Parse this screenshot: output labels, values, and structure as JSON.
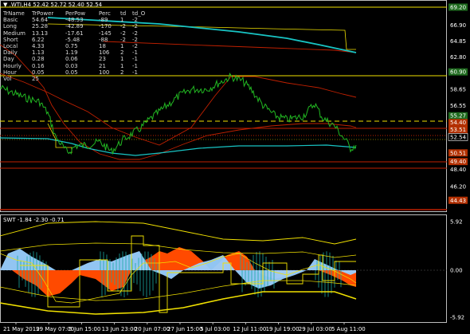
{
  "header": {
    "symbol": "▼ .WTI,H4",
    "ohlc": "52.42 52.72 52.40 52.54"
  },
  "table": {
    "columns": [
      "TrName",
      "TrPower",
      "PerPow",
      "Perc",
      "td",
      "td_O"
    ],
    "rows": [
      [
        "Basic",
        "54.64",
        "-48.53",
        "-89",
        "1",
        "-2"
      ],
      [
        "Long",
        "25.28",
        "-42.89",
        "-170",
        "-2",
        "-2"
      ],
      [
        "Medium",
        "13.13",
        "-17.61",
        "-145",
        "-2",
        "-2"
      ],
      [
        "Short",
        "6.22",
        "-5.48",
        "-88",
        "-2",
        "-2"
      ],
      [
        "Local",
        "4.33",
        "0.75",
        "18",
        "1",
        "-2"
      ],
      [
        "Daily",
        "1.13",
        "1.19",
        "106",
        "2",
        "-1"
      ],
      [
        "Day",
        "0.28",
        "0.06",
        "23",
        "1",
        "-1"
      ],
      [
        "Hourly",
        "0.16",
        "0.03",
        "21",
        "1",
        "-1"
      ],
      [
        "Hour",
        "0.05",
        "0.05",
        "100",
        "2",
        "-1"
      ],
      [
        "Vol",
        "25",
        "",
        "",
        "",
        ""
      ]
    ]
  },
  "price_axis": {
    "labels": [
      "69.20",
      "66.90",
      "64.85",
      "62.80",
      "60.90",
      "58.65",
      "56.55",
      "55.27",
      "54.40",
      "53.51",
      "52.54",
      "50.51",
      "49.40",
      "48.40",
      "46.20",
      "44.43"
    ],
    "highlighted": {
      "69.20": "#1f6b1f",
      "60.90": "#1f6b1f",
      "55.27": "#1f6b1f",
      "54.40": "#b33000",
      "53.51": "#b33000",
      "50.51": "#b33000",
      "49.40": "#b33000",
      "44.43": "#b33000",
      "52.54": "#000000"
    }
  },
  "oscillator": {
    "title": "SWT -1.84 -2.30 -0.71",
    "axis_labels": [
      "5.92",
      "0.00",
      "-5.92"
    ]
  },
  "time_axis": {
    "labels": [
      "21 May 2019",
      "29 May 07:00",
      "5 Jun 15:00",
      "13 Jun 23:00",
      "20 Jun 07:00",
      "27 Jun 15:00",
      "5 Jul 03:00",
      "12 Jul 11:00",
      "19 Jul 19:00",
      "29 Jul 03:00",
      "5 Aug 11:00"
    ]
  },
  "colors": {
    "price": "#22b822",
    "teal": "#18c4c4",
    "red": "#c02000",
    "yellow": "#f0e000",
    "orange": "#ff4a00",
    "blue": "#9ad0ff"
  }
}
